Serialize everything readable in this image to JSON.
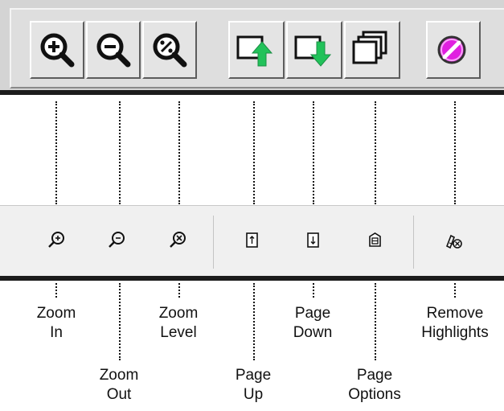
{
  "labels": {
    "zoom_in": {
      "line1": "Zoom",
      "line2": "In"
    },
    "zoom_out": {
      "line1": "Zoom",
      "line2": "Out"
    },
    "zoom_level": {
      "line1": "Zoom",
      "line2": "Level"
    },
    "page_up": {
      "line1": "Page",
      "line2": "Up"
    },
    "page_down": {
      "line1": "Page",
      "line2": "Down"
    },
    "page_options": {
      "line1": "Page",
      "line2": "Options"
    },
    "remove_highlights": {
      "line1": "Remove",
      "line2": "Highlights"
    }
  },
  "old_toolbar_icons": [
    "zoom-in-icon",
    "zoom-out-icon",
    "zoom-level-icon",
    "page-up-icon",
    "page-down-icon",
    "page-options-icon",
    "remove-highlights-icon"
  ],
  "new_toolbar_icons": [
    "zoom-in-icon",
    "zoom-out-icon",
    "zoom-level-icon",
    "page-up-icon",
    "page-down-icon",
    "page-options-icon",
    "remove-highlights-icon"
  ],
  "colors": {
    "old_arrow_green": "#22c25a",
    "old_highlight_magenta": "#e020e0",
    "toolbar_new_bg": "#f0f0f0",
    "toolbar_old_bg": "#d4d4d4"
  }
}
